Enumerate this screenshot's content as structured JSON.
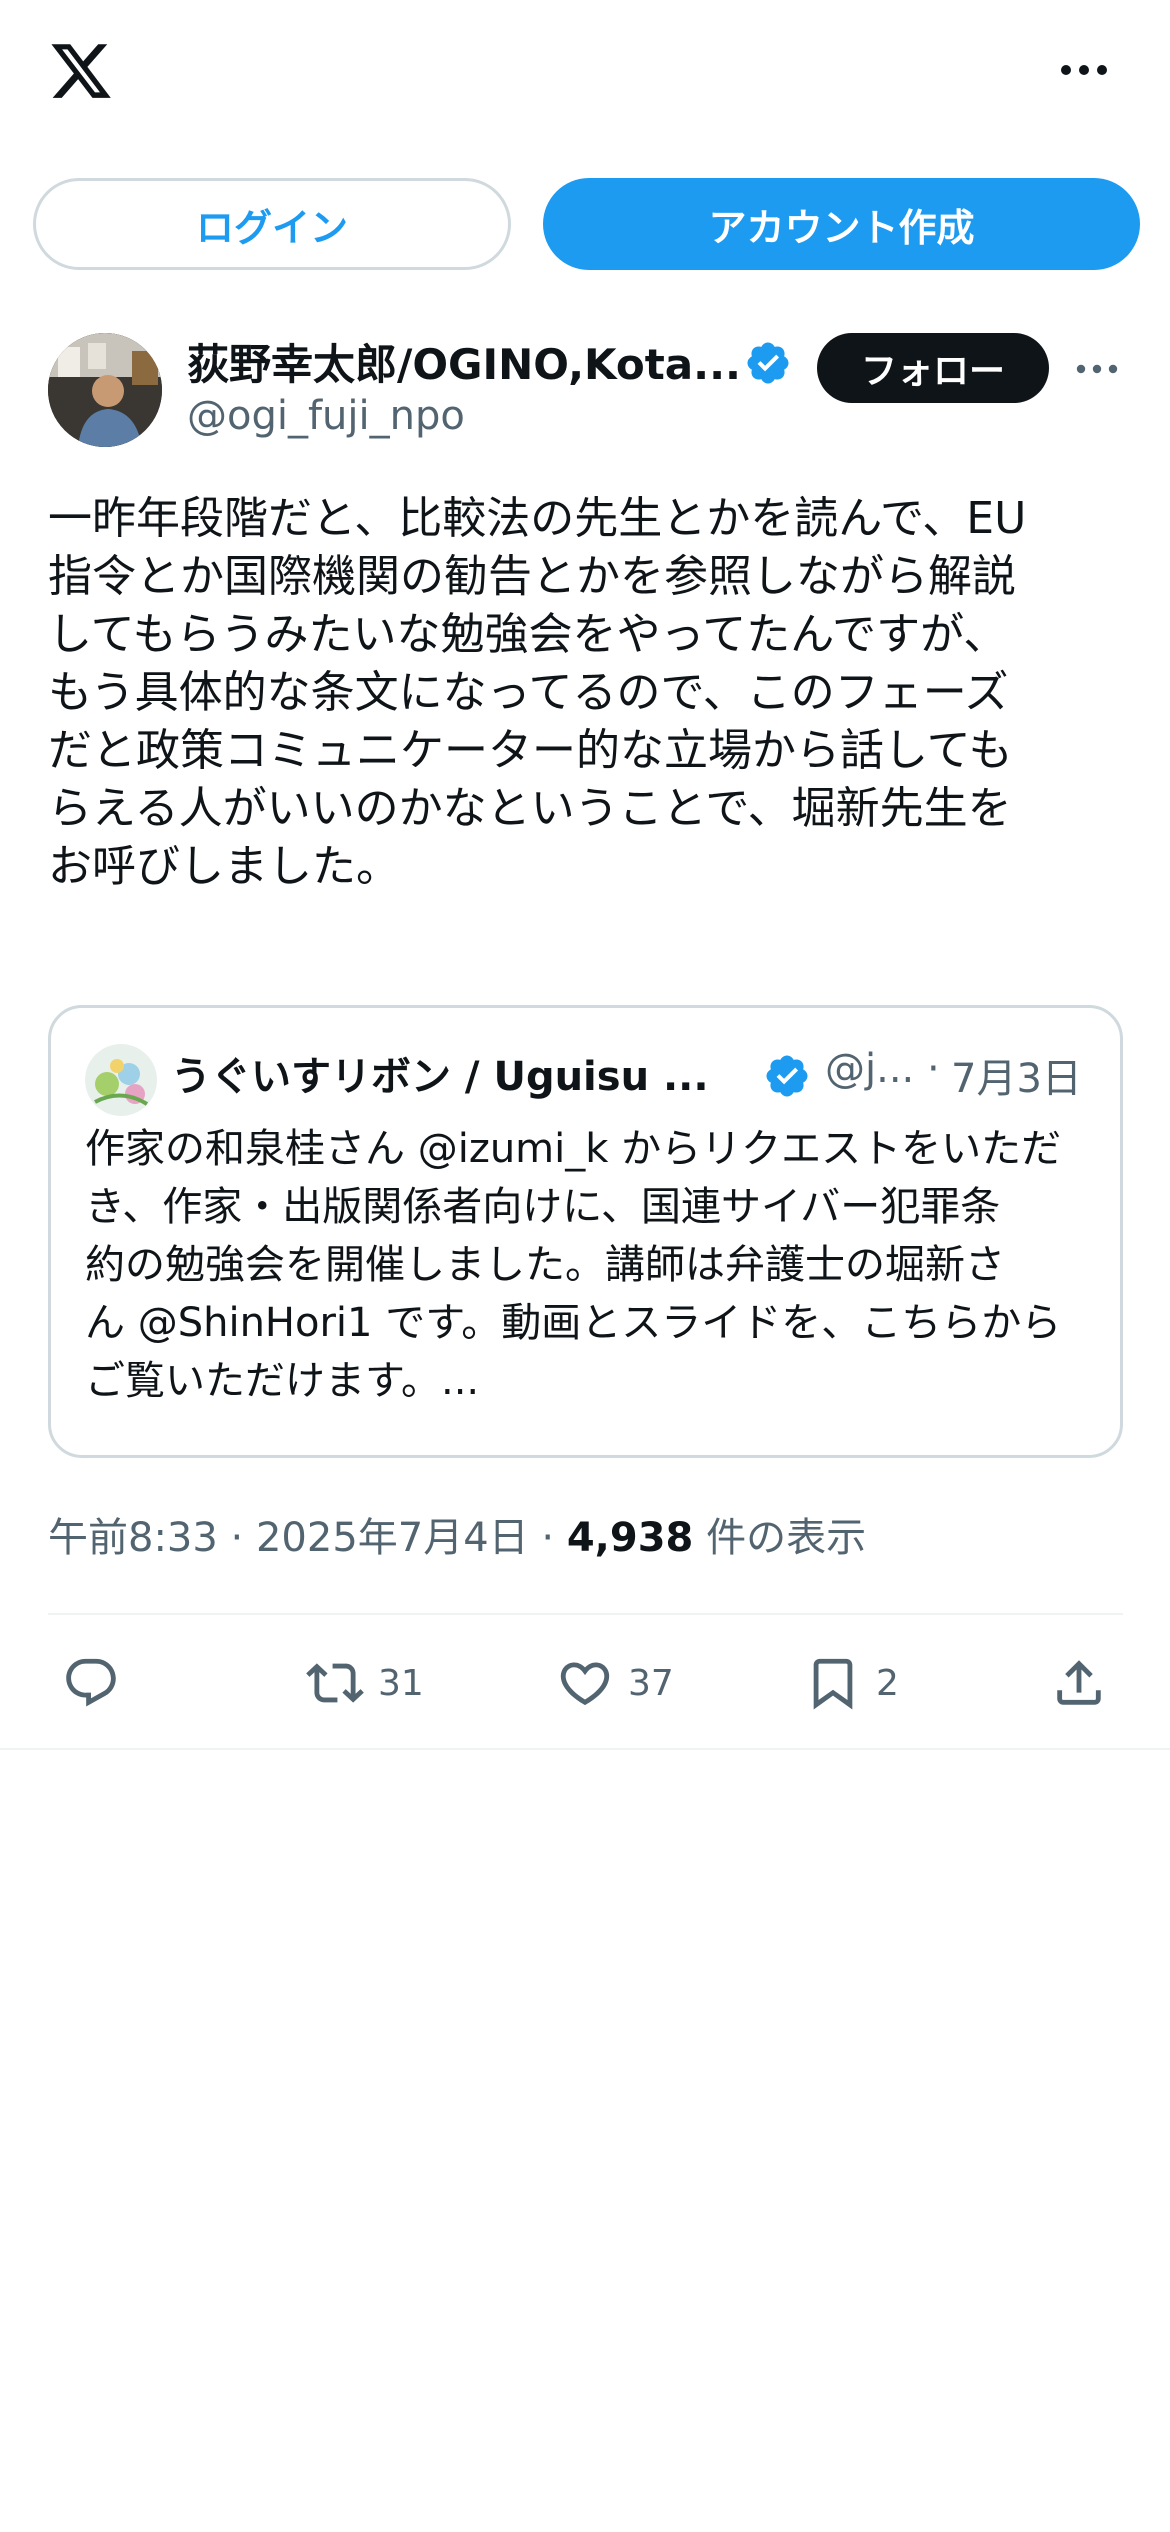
{
  "topbar": {
    "logo_icon": "x-logo-icon",
    "more_icon": "more-horizontal-icon"
  },
  "auth": {
    "login_label": "ログイン",
    "signup_label": "アカウント作成"
  },
  "author": {
    "display_name": "荻野幸太郎/OGINO,Kota...",
    "handle": "@ogi_fuji_npo",
    "follow_label": "フォロー",
    "verified_icon": "verified-badge-icon"
  },
  "tweet": {
    "text": "一昨年段階だと、比較法の先生とかを読んで、EU\n指令とか国際機関の勧告とかを参照しながら解説\nしてもらうみたいな勉強会をやってたんですが、\nもう具体的な条文になってるので、このフェーズ\nだと政策コミュニケーター的な立場から話しても\nらえる人がいいのかなということで、堀新先生を\nお呼びしました。"
  },
  "quote": {
    "display_name": "うぐいすリボン / Uguisu ...",
    "handle": "@j...",
    "separator": "·",
    "date": "7月3日",
    "text": "作家の和泉桂さん @izumi_k からリクエストをいただ\nき、作家・出版関係者向けに、国連サイバー犯罪条\n約の勉強会を開催しました。講師は弁護士の堀新さ\nん @ShinHori1 です。動画とスライドを、こちらから\nご覧いただけます。..."
  },
  "meta": {
    "time": "午前8:33",
    "sep1": " · ",
    "date": "2025年7月4日",
    "sep2": " · ",
    "views_count": "4,938",
    "views_label": " 件の表示"
  },
  "actions": {
    "reply_icon": "reply-icon",
    "retweet_icon": "retweet-icon",
    "retweet_count": "31",
    "like_icon": "heart-icon",
    "like_count": "37",
    "bookmark_icon": "bookmark-icon",
    "bookmark_count": "2",
    "share_icon": "share-icon"
  },
  "colors": {
    "accent": "#1d9bf0",
    "text_primary": "#0f1419",
    "text_secondary": "#536471",
    "border": "#cfd9de"
  }
}
